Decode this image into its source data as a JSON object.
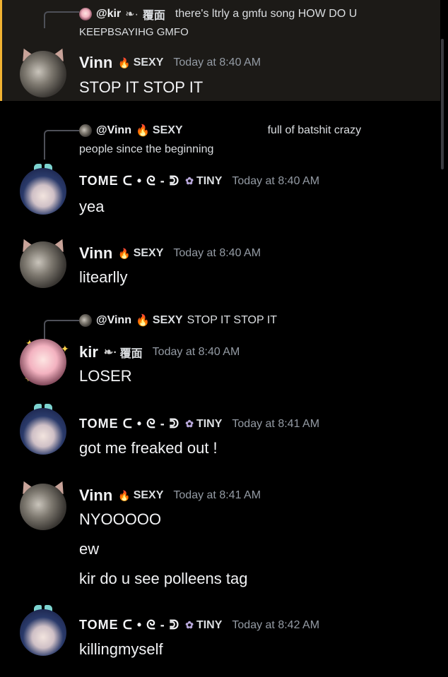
{
  "messages": [
    {
      "reply": {
        "author": "@kir",
        "tag": "覆面",
        "text1": "there's ltrly a gmfu song HOW DO U",
        "text2": "KEEPBSAYIHG GMFO"
      },
      "author": "Vinn",
      "tag": "SEXY",
      "time": "Today at 8:40 AM",
      "lines": [
        "STOP IT STOP IT"
      ]
    },
    {
      "reply": {
        "author": "@Vinn",
        "tag": "SEXY",
        "text1": "full of batshit crazy",
        "text2": "people since the beginning"
      },
      "author": "TOME",
      "author_suffix": "ᑕ • ᘓ - ᕲ",
      "tag": "TINY",
      "time": "Today at 8:40 AM",
      "lines": [
        "yea"
      ]
    },
    {
      "author": "Vinn",
      "tag": "SEXY",
      "time": "Today at 8:40 AM",
      "lines": [
        "litearlly"
      ]
    },
    {
      "reply": {
        "author": "@Vinn",
        "tag": "SEXY",
        "text1": "STOP IT STOP IT"
      },
      "author": "kir",
      "tag": "覆面",
      "time": "Today at 8:40 AM",
      "lines": [
        "LOSER"
      ]
    },
    {
      "author": "TOME",
      "author_suffix": "ᑕ • ᘓ - ᕲ",
      "tag": "TINY",
      "time": "Today at 8:41 AM",
      "lines": [
        "got me freaked out !"
      ]
    },
    {
      "author": "Vinn",
      "tag": "SEXY",
      "time": "Today at 8:41 AM",
      "lines": [
        "NYOOOOO",
        "ew",
        "kir do u see polleens tag"
      ]
    },
    {
      "author": "TOME",
      "author_suffix": "ᑕ • ᘓ - ᕲ",
      "tag": "TINY",
      "time": "Today at 8:42 AM",
      "lines": [
        "killingmyself"
      ]
    }
  ],
  "colors": {
    "background": "#000000",
    "highlight": "#1c1a17",
    "highlight_bar": "#f0b232",
    "timestamp": "#949ba4",
    "sexy_tag_icon": "#ff6b8a",
    "tiny_tag_icon": "#b7a7d9"
  },
  "icons": {
    "sexy_tag": "flame-icon",
    "tiny_tag": "flower-icon",
    "kir_tag": "leaf-icon"
  }
}
